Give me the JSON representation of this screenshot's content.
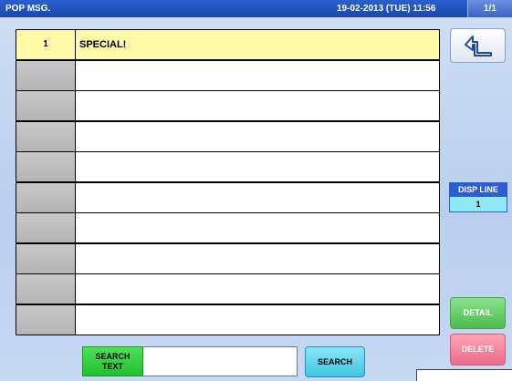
{
  "header": {
    "title": "POP MSG.",
    "datetime": "19-02-2013 (TUE) 11:56",
    "page": "1/1"
  },
  "list": {
    "rows": [
      {
        "num": "1",
        "text": "SPECIAL!",
        "selected": true
      },
      {
        "num": "",
        "text": ""
      },
      {
        "num": "",
        "text": ""
      },
      {
        "num": "",
        "text": ""
      },
      {
        "num": "",
        "text": ""
      },
      {
        "num": "",
        "text": ""
      },
      {
        "num": "",
        "text": ""
      },
      {
        "num": "",
        "text": ""
      },
      {
        "num": "",
        "text": ""
      },
      {
        "num": "",
        "text": ""
      }
    ]
  },
  "side": {
    "back_icon": "return-arrow-icon",
    "disp_line_label": "DISP LINE",
    "disp_line_value": "1",
    "detail_label": "DETAIL",
    "delete_label": "DELETE"
  },
  "search": {
    "label_line1": "SEARCH",
    "label_line2": "TEXT",
    "value": "",
    "button_label": "SEARCH"
  },
  "colors": {
    "titlebar": "#1a47b0",
    "selected_row": "#fff9a8",
    "detail": "#4cbc4c",
    "delete": "#ec6b88",
    "search_label": "#20c12f",
    "search_button": "#3fc6e4",
    "disp_line_value_bg": "#8fe8f3"
  }
}
